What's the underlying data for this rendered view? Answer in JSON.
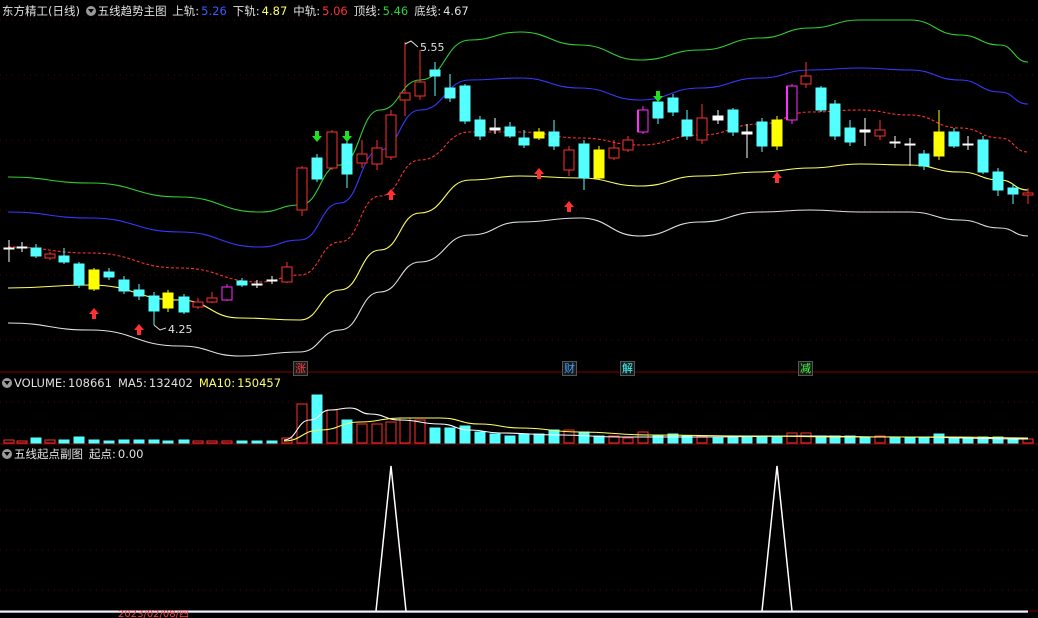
{
  "header_main": {
    "stock_name": "东方精工(日线)",
    "indicator": "五线趋势主图",
    "items": [
      {
        "label": "上轨:",
        "value": "5.26",
        "color": "#3a5bff"
      },
      {
        "label": "下轨:",
        "value": "4.87",
        "color": "#ffff60"
      },
      {
        "label": "中轨:",
        "value": "5.06",
        "color": "#ff3030"
      },
      {
        "label": "顶线:",
        "value": "5.46",
        "color": "#30d030"
      },
      {
        "label": "底线:",
        "value": "4.67",
        "color": "#e0e0e0"
      }
    ]
  },
  "annotations": {
    "high_label": "5.55",
    "low_label": "4.25"
  },
  "events": [
    {
      "label": "涨",
      "color": "#ff4040"
    },
    {
      "label": "财",
      "color": "#40a0ff"
    },
    {
      "label": "解",
      "color": "#40ffff"
    },
    {
      "label": "减",
      "color": "#40ff40"
    }
  ],
  "header_volume": {
    "label": "VOLUME:",
    "value": "108661",
    "ma5_label": "MA5:",
    "ma5_value": "132402",
    "ma10_label": "MA10:",
    "ma10_value": "150457"
  },
  "header_sub": {
    "indicator": "五线起点副图",
    "item_label": "起点:",
    "item_value": "0.00"
  },
  "bottom_axis": {
    "date": "2023/02/08/四"
  },
  "colors": {
    "up": "#ff3030",
    "down": "#54ffff",
    "yellow": "#ffff00",
    "magenta": "#ff30ff",
    "top_line": "#30d030",
    "upper": "#3030ff",
    "mid": "#ff3030",
    "lower": "#ffff60",
    "bottom_line": "#e0e0e0"
  }
}
